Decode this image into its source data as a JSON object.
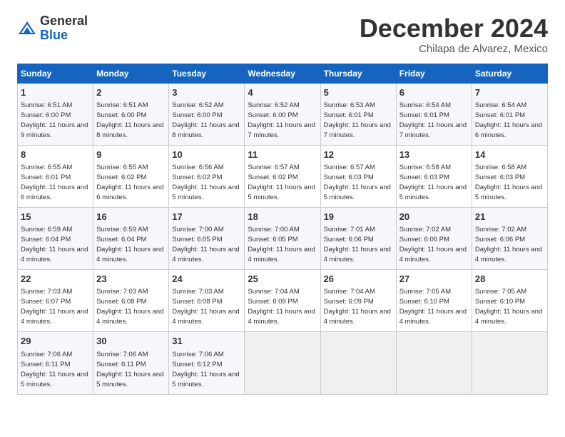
{
  "logo": {
    "general": "General",
    "blue": "Blue"
  },
  "header": {
    "month": "December 2024",
    "location": "Chilapa de Alvarez, Mexico"
  },
  "weekdays": [
    "Sunday",
    "Monday",
    "Tuesday",
    "Wednesday",
    "Thursday",
    "Friday",
    "Saturday"
  ],
  "weeks": [
    [
      {
        "day": "1",
        "sunrise": "6:51 AM",
        "sunset": "6:00 PM",
        "daylight": "11 hours and 9 minutes."
      },
      {
        "day": "2",
        "sunrise": "6:51 AM",
        "sunset": "6:00 PM",
        "daylight": "11 hours and 8 minutes."
      },
      {
        "day": "3",
        "sunrise": "6:52 AM",
        "sunset": "6:00 PM",
        "daylight": "11 hours and 8 minutes."
      },
      {
        "day": "4",
        "sunrise": "6:52 AM",
        "sunset": "6:00 PM",
        "daylight": "11 hours and 7 minutes."
      },
      {
        "day": "5",
        "sunrise": "6:53 AM",
        "sunset": "6:01 PM",
        "daylight": "11 hours and 7 minutes."
      },
      {
        "day": "6",
        "sunrise": "6:54 AM",
        "sunset": "6:01 PM",
        "daylight": "11 hours and 7 minutes."
      },
      {
        "day": "7",
        "sunrise": "6:54 AM",
        "sunset": "6:01 PM",
        "daylight": "11 hours and 6 minutes."
      }
    ],
    [
      {
        "day": "8",
        "sunrise": "6:55 AM",
        "sunset": "6:01 PM",
        "daylight": "11 hours and 6 minutes."
      },
      {
        "day": "9",
        "sunrise": "6:55 AM",
        "sunset": "6:02 PM",
        "daylight": "11 hours and 6 minutes."
      },
      {
        "day": "10",
        "sunrise": "6:56 AM",
        "sunset": "6:02 PM",
        "daylight": "11 hours and 5 minutes."
      },
      {
        "day": "11",
        "sunrise": "6:57 AM",
        "sunset": "6:02 PM",
        "daylight": "11 hours and 5 minutes."
      },
      {
        "day": "12",
        "sunrise": "6:57 AM",
        "sunset": "6:03 PM",
        "daylight": "11 hours and 5 minutes."
      },
      {
        "day": "13",
        "sunrise": "6:58 AM",
        "sunset": "6:03 PM",
        "daylight": "11 hours and 5 minutes."
      },
      {
        "day": "14",
        "sunrise": "6:58 AM",
        "sunset": "6:03 PM",
        "daylight": "11 hours and 5 minutes."
      }
    ],
    [
      {
        "day": "15",
        "sunrise": "6:59 AM",
        "sunset": "6:04 PM",
        "daylight": "11 hours and 4 minutes."
      },
      {
        "day": "16",
        "sunrise": "6:59 AM",
        "sunset": "6:04 PM",
        "daylight": "11 hours and 4 minutes."
      },
      {
        "day": "17",
        "sunrise": "7:00 AM",
        "sunset": "6:05 PM",
        "daylight": "11 hours and 4 minutes."
      },
      {
        "day": "18",
        "sunrise": "7:00 AM",
        "sunset": "6:05 PM",
        "daylight": "11 hours and 4 minutes."
      },
      {
        "day": "19",
        "sunrise": "7:01 AM",
        "sunset": "6:06 PM",
        "daylight": "11 hours and 4 minutes."
      },
      {
        "day": "20",
        "sunrise": "7:02 AM",
        "sunset": "6:06 PM",
        "daylight": "11 hours and 4 minutes."
      },
      {
        "day": "21",
        "sunrise": "7:02 AM",
        "sunset": "6:06 PM",
        "daylight": "11 hours and 4 minutes."
      }
    ],
    [
      {
        "day": "22",
        "sunrise": "7:03 AM",
        "sunset": "6:07 PM",
        "daylight": "11 hours and 4 minutes."
      },
      {
        "day": "23",
        "sunrise": "7:03 AM",
        "sunset": "6:08 PM",
        "daylight": "11 hours and 4 minutes."
      },
      {
        "day": "24",
        "sunrise": "7:03 AM",
        "sunset": "6:08 PM",
        "daylight": "11 hours and 4 minutes."
      },
      {
        "day": "25",
        "sunrise": "7:04 AM",
        "sunset": "6:09 PM",
        "daylight": "11 hours and 4 minutes."
      },
      {
        "day": "26",
        "sunrise": "7:04 AM",
        "sunset": "6:09 PM",
        "daylight": "11 hours and 4 minutes."
      },
      {
        "day": "27",
        "sunrise": "7:05 AM",
        "sunset": "6:10 PM",
        "daylight": "11 hours and 4 minutes."
      },
      {
        "day": "28",
        "sunrise": "7:05 AM",
        "sunset": "6:10 PM",
        "daylight": "11 hours and 4 minutes."
      }
    ],
    [
      {
        "day": "29",
        "sunrise": "7:06 AM",
        "sunset": "6:11 PM",
        "daylight": "11 hours and 5 minutes."
      },
      {
        "day": "30",
        "sunrise": "7:06 AM",
        "sunset": "6:11 PM",
        "daylight": "11 hours and 5 minutes."
      },
      {
        "day": "31",
        "sunrise": "7:06 AM",
        "sunset": "6:12 PM",
        "daylight": "11 hours and 5 minutes."
      },
      null,
      null,
      null,
      null
    ]
  ]
}
